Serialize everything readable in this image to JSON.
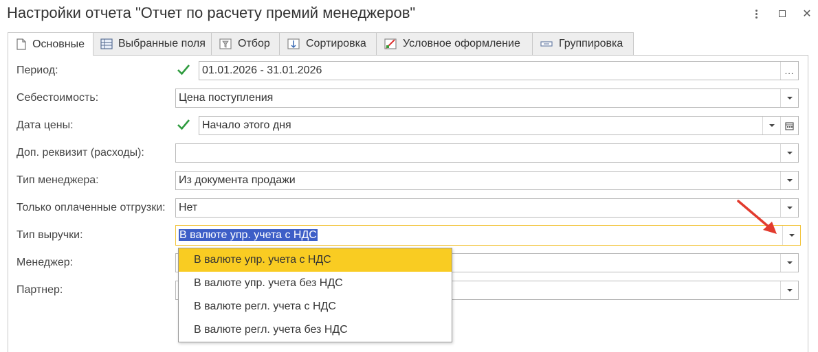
{
  "window": {
    "title": "Настройки отчета \"Отчет по расчету премий менеджеров\"",
    "more_icon": "more-vertical-icon",
    "maximize_icon": "maximize-icon",
    "close_glyph": "✕"
  },
  "tabs": [
    {
      "label": "Основные",
      "icon": "document-icon"
    },
    {
      "label": "Выбранные поля",
      "icon": "fields-icon"
    },
    {
      "label": "Отбор",
      "icon": "filter-icon"
    },
    {
      "label": "Сортировка",
      "icon": "sort-icon"
    },
    {
      "label": "Условное оформление",
      "icon": "conditional-format-icon"
    },
    {
      "label": "Группировка",
      "icon": "grouping-icon"
    }
  ],
  "form": {
    "period": {
      "label": "Период:",
      "value": "01.01.2026 - 31.01.2026",
      "checked": true,
      "button": "..."
    },
    "cost": {
      "label": "Себестоимость:",
      "value": "Цена поступления"
    },
    "price_date": {
      "label": "Дата цены:",
      "value": "Начало этого дня",
      "checked": true
    },
    "extra_attr": {
      "label": "Доп. реквизит (расходы):",
      "value": ""
    },
    "manager_type": {
      "label": "Тип менеджера:",
      "value": "Из документа продажи"
    },
    "paid_only": {
      "label": "Только оплаченные отгрузки:",
      "value": "Нет"
    },
    "revenue_type": {
      "label": "Тип выручки:",
      "value": "В валюте упр. учета с НДС"
    },
    "manager": {
      "label": "Менеджер:",
      "value": ""
    },
    "partner": {
      "label": "Партнер:",
      "value": ""
    }
  },
  "dropdown": {
    "options": [
      "В валюте упр. учета с НДС",
      "В валюте упр. учета без НДС",
      "В валюте регл. учета с НДС",
      "В валюте регл. учета без НДС"
    ],
    "highlighted_index": 0
  },
  "colors": {
    "check": "#2e9b3e",
    "highlight": "#f9cc22",
    "selection": "#3d5ec7",
    "focus_border": "#f2c43a",
    "arrow": "#e23b2e"
  }
}
